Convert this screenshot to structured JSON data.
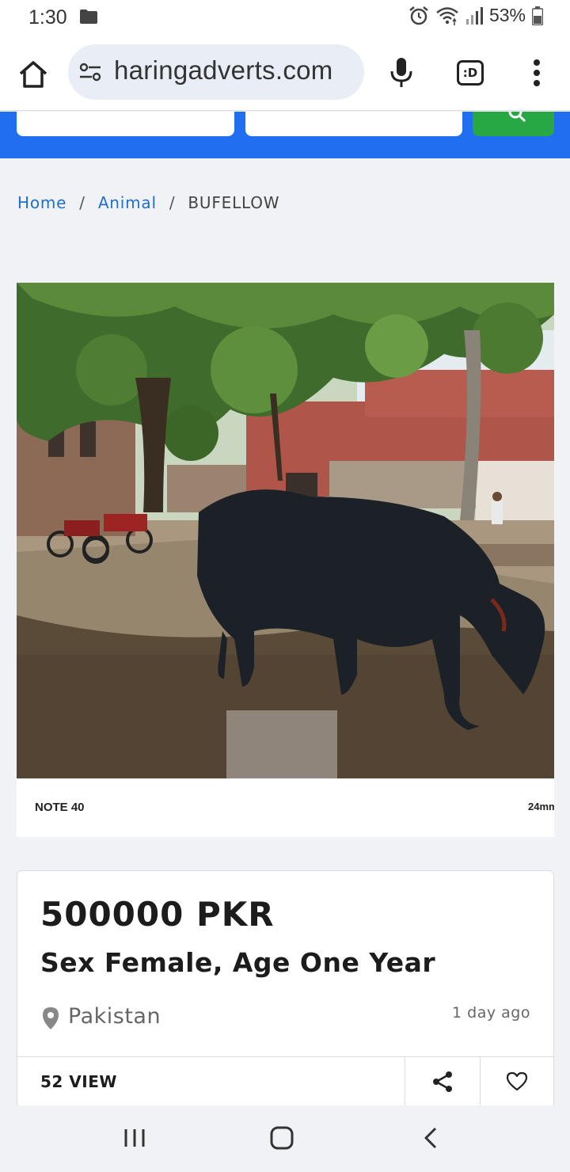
{
  "status_bar": {
    "time": "1:30",
    "battery": "53%",
    "icons": [
      "folder-icon",
      "alarm-icon",
      "wifi-icon",
      "signal-icon",
      "battery-icon"
    ]
  },
  "browser": {
    "url": "haringadverts.com",
    "tabs_label": ":D",
    "icons": [
      "home-icon",
      "site-settings-icon",
      "mic-icon",
      "tab-switcher-icon",
      "more-vert-icon"
    ]
  },
  "breadcrumb": {
    "home": "Home",
    "category": "Animal",
    "current": "BUFELLOW",
    "separator": "/"
  },
  "photo": {
    "alt": "Black buffalo grazing under a tree",
    "caption_left": "NOTE 40",
    "caption_right": "24mm"
  },
  "listing": {
    "price": "500000 PKR",
    "title": "Sex Female, Age One Year",
    "location": "Pakistan",
    "posted": "1 day ago",
    "views": "52 VIEW"
  },
  "colors": {
    "brand_blue": "#1f6ff0",
    "search_green": "#28a745",
    "link_blue": "#1f6fd0"
  }
}
